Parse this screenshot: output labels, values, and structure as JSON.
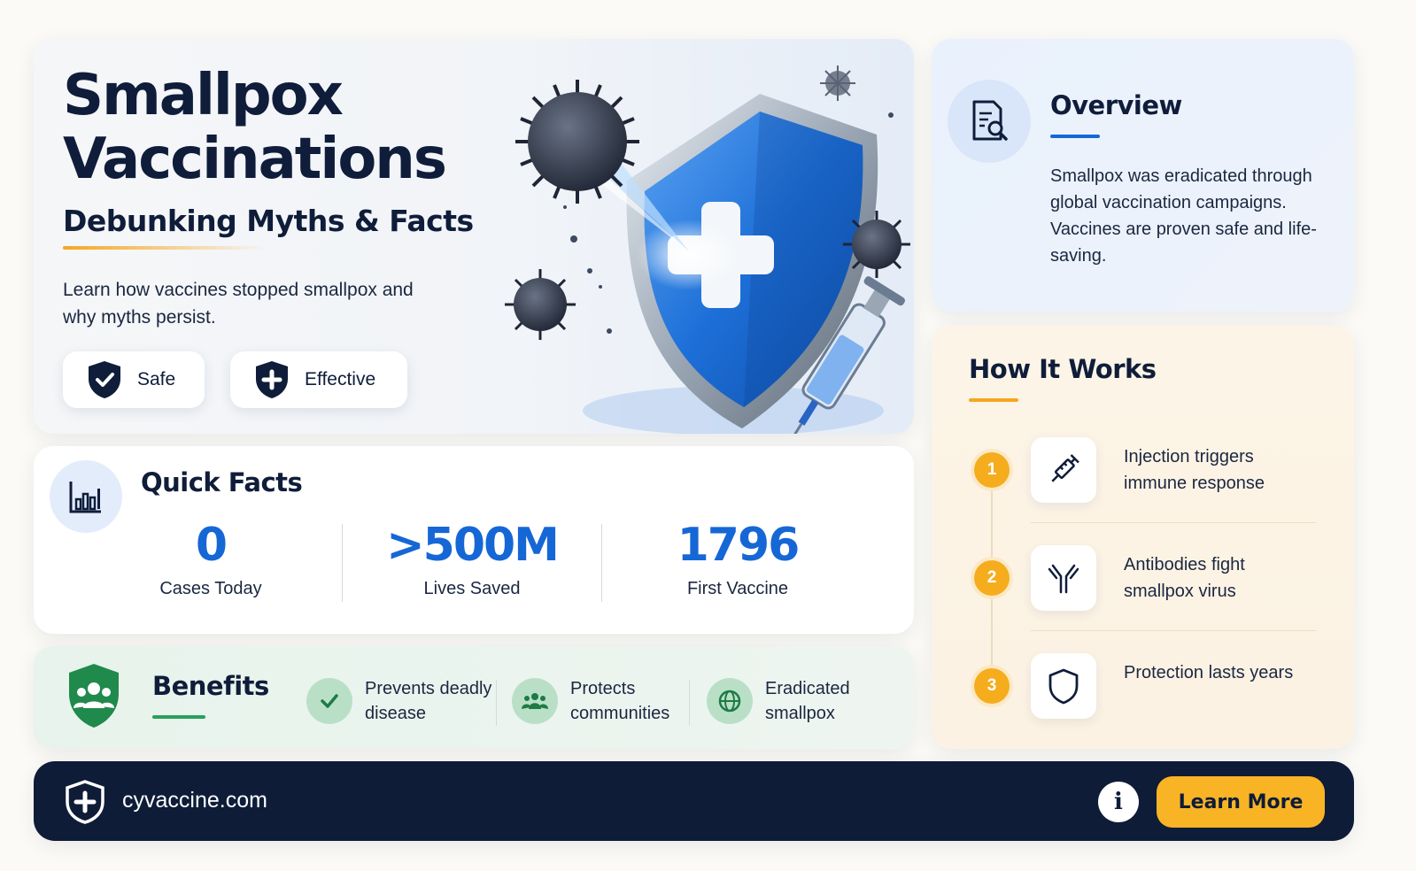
{
  "hero": {
    "title_line1": "Smallpox",
    "title_line2": "Vaccinations",
    "subtitle": "Debunking Myths & Facts",
    "description": "Learn how vaccines stopped smallpox and why myths persist.",
    "pills": [
      {
        "label": "Safe",
        "icon": "shield-check-icon"
      },
      {
        "label": "Effective",
        "icon": "shield-plus-icon"
      }
    ],
    "illustration": "shield-virus-syringe-illustration"
  },
  "quick_facts": {
    "title": "Quick Facts",
    "icon": "bar-chart-icon",
    "stats": [
      {
        "value": "0",
        "label": "Cases Today"
      },
      {
        "value": ">500M",
        "label": "Lives Saved"
      },
      {
        "value": "1796",
        "label": "First Vaccine"
      }
    ]
  },
  "benefits": {
    "title": "Benefits",
    "icon": "shield-people-icon",
    "items": [
      {
        "text": "Prevents deadly disease",
        "icon": "check-icon"
      },
      {
        "text": "Protects communities",
        "icon": "people-icon"
      },
      {
        "text": "Eradicated smallpox",
        "icon": "globe-icon"
      }
    ]
  },
  "overview": {
    "title": "Overview",
    "icon": "document-search-icon",
    "text": "Smallpox was eradicated through global vaccination campaigns. Vaccines are proven safe and life-saving."
  },
  "how_it_works": {
    "title": "How It Works",
    "steps": [
      {
        "number": "1",
        "text": "Injection triggers immune response",
        "icon": "syringe-icon"
      },
      {
        "number": "2",
        "text": "Antibodies fight smallpox virus",
        "icon": "antibody-icon"
      },
      {
        "number": "3",
        "text": "Protection lasts years",
        "icon": "shield-outline-icon"
      }
    ]
  },
  "footer": {
    "domain": "cyvaccine.com",
    "info_label": "i",
    "cta_label": "Learn More"
  },
  "colors": {
    "navy": "#0e1c38",
    "accent_blue": "#1667d6",
    "accent_yellow": "#f5a623",
    "accent_green": "#2aa05a"
  }
}
